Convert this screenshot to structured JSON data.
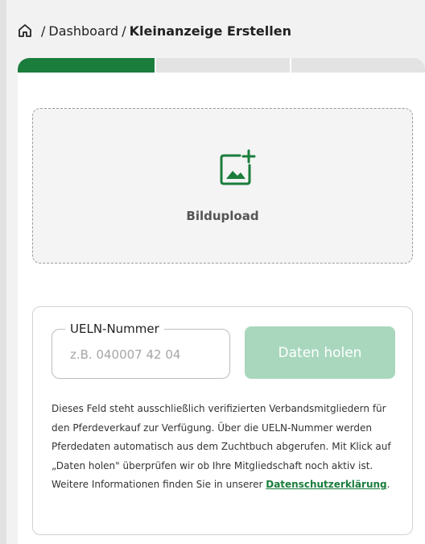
{
  "breadcrumb": {
    "home_icon": "home-icon",
    "separator": "/",
    "dashboard": "Dashboard",
    "current": "Kleinanzeige Erstellen"
  },
  "stepper": {
    "steps": [
      {
        "state": "active"
      },
      {
        "state": "inactive"
      },
      {
        "state": "inactive"
      }
    ],
    "active_color": "#1a7d3c",
    "inactive_color": "#e3e3e3"
  },
  "upload": {
    "icon": "image-add-icon",
    "label": "Bildupload",
    "accent_color": "#1a7d3c"
  },
  "ueln": {
    "legend": "UELN-Nummer",
    "placeholder": "z.B. 040007 42 04",
    "value": "",
    "button_label": "Daten holen",
    "button_color": "#a8d7bd",
    "info_text_before_link": "Dieses Feld steht ausschließlich verifizierten Verbandsmitgliedern für den Pferdeverkauf zur Verfügung. Über die UELN-Nummer werden Pferdedaten automatisch aus dem Zuchtbuch abgerufen. Mit Klick auf „Daten holen\" überprüfen wir ob Ihre Mitgliedschaft noch aktiv ist. Weitere Informationen finden Sie in unserer ",
    "info_link": "Datenschutzerklärung",
    "info_text_after_link": "."
  }
}
